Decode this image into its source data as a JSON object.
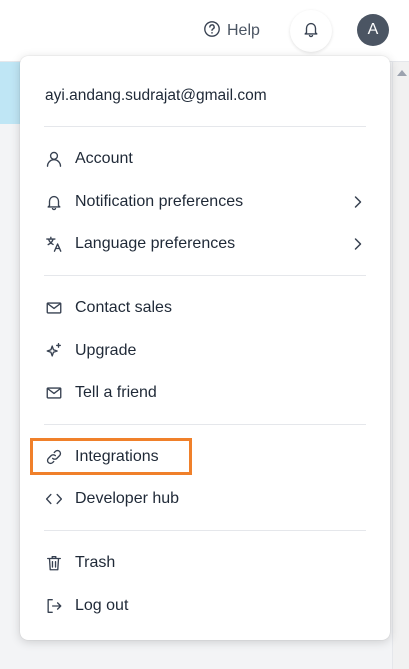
{
  "header": {
    "help_label": "Help",
    "notifications_icon": "bell-icon",
    "avatar_initial": "A"
  },
  "menu": {
    "email": "ayi.andang.sudrajat@gmail.com",
    "items": [
      {
        "label": "Account",
        "icon": "user-icon"
      },
      {
        "label": "Notification preferences",
        "icon": "bell-icon",
        "has_submenu": true
      },
      {
        "label": "Language preferences",
        "icon": "translate-icon",
        "has_submenu": true
      },
      {
        "label": "Contact sales",
        "icon": "mail-icon"
      },
      {
        "label": "Upgrade",
        "icon": "sparkle-icon"
      },
      {
        "label": "Tell a friend",
        "icon": "mail-icon"
      },
      {
        "label": "Integrations",
        "icon": "link-icon",
        "highlighted": true
      },
      {
        "label": "Developer hub",
        "icon": "code-icon"
      },
      {
        "label": "Trash",
        "icon": "trash-icon"
      },
      {
        "label": "Log out",
        "icon": "logout-icon"
      }
    ]
  },
  "colors": {
    "highlight": "#f0802a",
    "avatar_bg": "#4b5563",
    "accent_strip": "#bfe6f5"
  }
}
